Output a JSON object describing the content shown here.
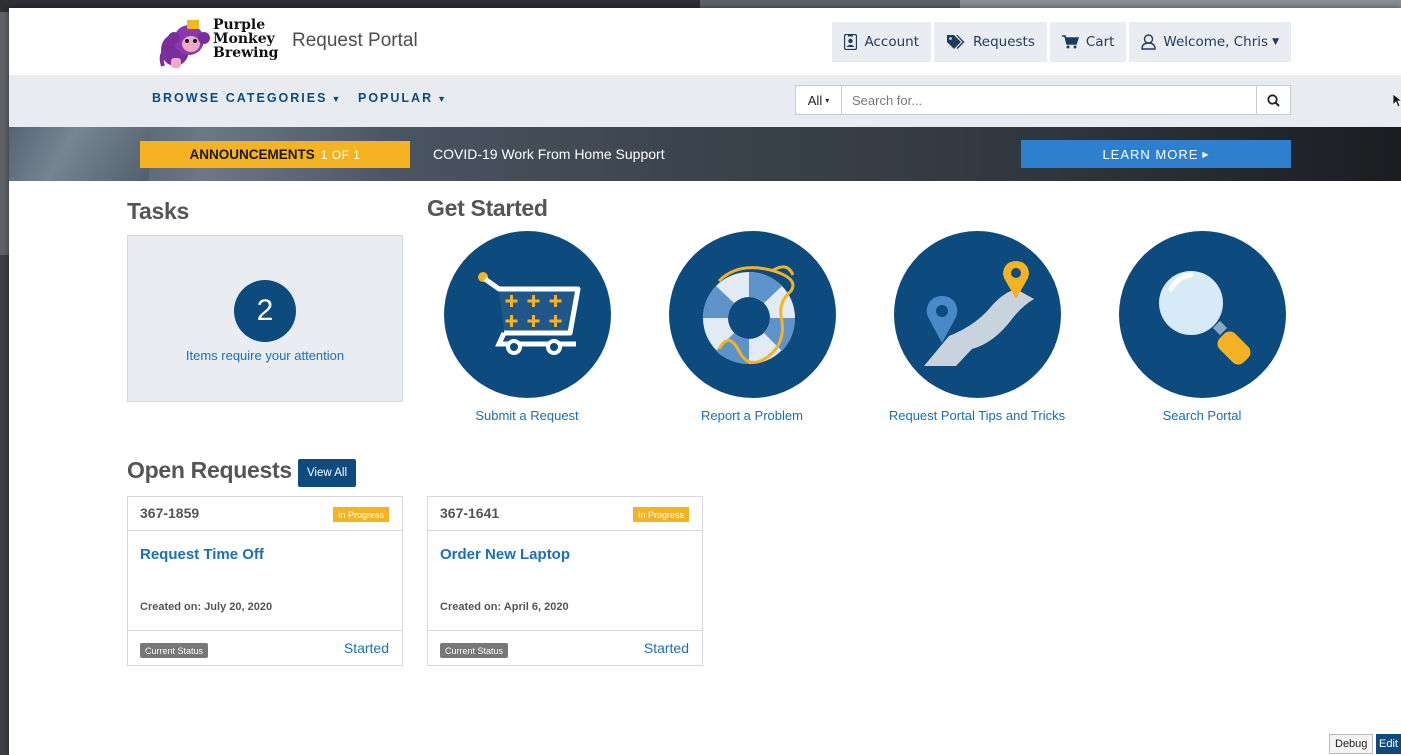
{
  "header": {
    "logo_lines": [
      "Purple",
      "Monkey",
      "Brewing"
    ],
    "portal_title": "Request Portal",
    "nav": [
      {
        "label": "Account",
        "icon": "id-badge-icon"
      },
      {
        "label": "Requests",
        "icon": "tags-icon"
      },
      {
        "label": "Cart",
        "icon": "cart-icon"
      },
      {
        "label": "Welcome, Chris",
        "icon": "user-icon"
      }
    ]
  },
  "subnav": {
    "browse_label": "BROWSE CATEGORIES",
    "popular_label": "POPULAR",
    "search_scope": "All",
    "search_placeholder": "Search for..."
  },
  "announcement": {
    "label": "ANNOUNCEMENTS",
    "count": "1 OF 1",
    "text": "COVID-19 Work From Home Support",
    "button": "LEARN MORE"
  },
  "tasks": {
    "title": "Tasks",
    "count": "2",
    "caption": "Items require your attention"
  },
  "get_started": {
    "title": "Get Started",
    "items": [
      {
        "label": "Submit a Request",
        "icon": "cart-icon"
      },
      {
        "label": "Report a Problem",
        "icon": "lifebuoy-icon"
      },
      {
        "label": "Request Portal Tips and Tricks",
        "icon": "map-route-icon"
      },
      {
        "label": "Search Portal",
        "icon": "magnifier-icon"
      }
    ]
  },
  "open_requests": {
    "title": "Open Requests",
    "view_all": "View All",
    "cards": [
      {
        "number": "367-1859",
        "badge": "In Progress",
        "name": "Request Time Off",
        "created_label": "Created on:",
        "created_date": "July 20, 2020",
        "status_tag": "Current Status",
        "status": "Started"
      },
      {
        "number": "367-1641",
        "badge": "In Progress",
        "name": "Order New Laptop",
        "created_label": "Created on:",
        "created_date": "April 6, 2020",
        "status_tag": "Current Status",
        "status": "Started"
      }
    ]
  },
  "footer_buttons": {
    "debug": "Debug",
    "edit": "Edit"
  },
  "colors": {
    "brand_navy": "#0d4a7e",
    "accent_yellow": "#f5b324",
    "link_blue": "#1a6fb5",
    "button_blue": "#2f7fcf"
  }
}
